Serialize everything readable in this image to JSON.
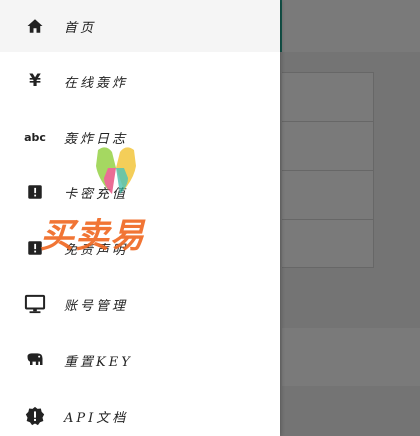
{
  "colors": {
    "accent": "#2bb5a0",
    "watermark_orange": "#f06a24",
    "overlay": "rgba(0,0,0,0.52)"
  },
  "nav": {
    "items": [
      {
        "label": "首页",
        "icon": "home-icon",
        "active": true
      },
      {
        "label": "在线轰炸",
        "icon": "yen-icon",
        "active": false
      },
      {
        "label": "轰炸日志",
        "icon": "abc-icon",
        "active": false
      },
      {
        "label": "卡密充值",
        "icon": "alert-box-icon",
        "active": false
      },
      {
        "label": "免责声明",
        "icon": "alert-box-icon",
        "active": false
      },
      {
        "label": "账号管理",
        "icon": "monitor-icon",
        "active": false
      },
      {
        "label": "重置KEY",
        "icon": "elephant-icon",
        "active": false
      },
      {
        "label": "API文档",
        "icon": "alert-badge-icon",
        "active": false
      }
    ],
    "yen_glyph": "¥",
    "abc_glyph": "abc"
  },
  "watermark": {
    "text": "买卖易"
  }
}
